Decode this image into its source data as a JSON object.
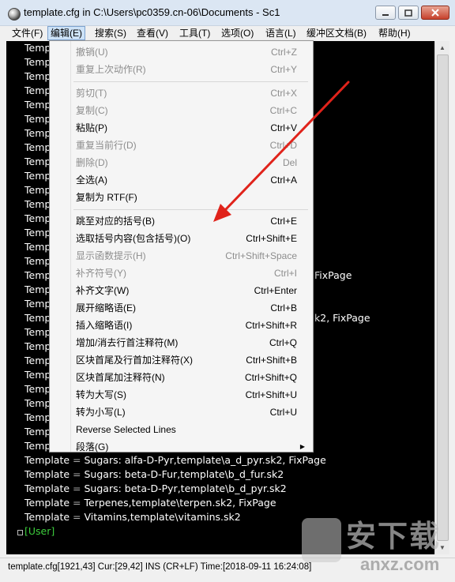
{
  "window": {
    "title": "template.cfg in C:\\Users\\pc0359.cn-06\\Documents - Sc1"
  },
  "menubar": [
    "文件(F)",
    "编辑(E)",
    "搜索(S)",
    "查看(V)",
    "工具(T)",
    "选项(O)",
    "语言(L)",
    "缓冲区文档(B)",
    "帮助(H)"
  ],
  "editor": {
    "hidden_prefix": "Temp",
    "visible_lines": [
      {
        "key": "Template",
        "op": "=",
        "value": "Sugars: alfa-D-Pyr,template\\a_d_pyr.sk2, FixPage"
      },
      {
        "key": "Template",
        "op": "=",
        "value": "Sugars: beta-D-Fur,template\\b_d_fur.sk2"
      },
      {
        "key": "Template",
        "op": "=",
        "value": "Sugars: beta-D-Pyr,template\\b_d_pyr.sk2"
      },
      {
        "key": "Template",
        "op": "=",
        "value": "Terpenes,template\\terpen.sk2, FixPage"
      },
      {
        "key": "Template",
        "op": "=",
        "value": "Vitamins,template\\vitamins.sk2"
      }
    ],
    "section": "[User]",
    "fragments": {
      "fixpage_a": "FixPage",
      "fixpage_b": "k2, FixPage"
    }
  },
  "edit_menu": {
    "items": [
      {
        "label": "撤销(U)",
        "shortcut": "Ctrl+Z",
        "enabled": false
      },
      {
        "label": "重复上次动作(R)",
        "shortcut": "Ctrl+Y",
        "enabled": false
      },
      {
        "label": "剪切(T)",
        "shortcut": "Ctrl+X",
        "enabled": false
      },
      {
        "label": "复制(C)",
        "shortcut": "Ctrl+C",
        "enabled": false
      },
      {
        "label": "粘贴(P)",
        "shortcut": "Ctrl+V",
        "enabled": true
      },
      {
        "label": "重复当前行(D)",
        "shortcut": "Ctrl+D",
        "enabled": false
      },
      {
        "label": "删除(D)",
        "shortcut": "Del",
        "enabled": false
      },
      {
        "label": "全选(A)",
        "shortcut": "Ctrl+A",
        "enabled": true
      },
      {
        "label": "复制为 RTF(F)",
        "shortcut": "",
        "enabled": true
      },
      {
        "label": "跳至对应的括号(B)",
        "shortcut": "Ctrl+E",
        "enabled": true
      },
      {
        "label": "选取括号内容(包含括号)(O)",
        "shortcut": "Ctrl+Shift+E",
        "enabled": true
      },
      {
        "label": "显示函数提示(H)",
        "shortcut": "Ctrl+Shift+Space",
        "enabled": false
      },
      {
        "label": "补齐符号(Y)",
        "shortcut": "Ctrl+I",
        "enabled": false
      },
      {
        "label": "补齐文字(W)",
        "shortcut": "Ctrl+Enter",
        "enabled": true
      },
      {
        "label": "展开缩略语(E)",
        "shortcut": "Ctrl+B",
        "enabled": true
      },
      {
        "label": "插入缩略语(I)",
        "shortcut": "Ctrl+Shift+R",
        "enabled": true
      },
      {
        "label": "增加/消去行首注释符(M)",
        "shortcut": "Ctrl+Q",
        "enabled": true
      },
      {
        "label": "区块首尾及行首加注释符(X)",
        "shortcut": "Ctrl+Shift+B",
        "enabled": true
      },
      {
        "label": "区块首尾加注释符(N)",
        "shortcut": "Ctrl+Shift+Q",
        "enabled": true
      },
      {
        "label": "转为大写(S)",
        "shortcut": "Ctrl+Shift+U",
        "enabled": true
      },
      {
        "label": "转为小写(L)",
        "shortcut": "Ctrl+U",
        "enabled": true
      },
      {
        "label": "Reverse Selected Lines",
        "shortcut": "",
        "enabled": true
      },
      {
        "label": "段落(G)",
        "shortcut": "",
        "enabled": true,
        "submenu": true
      }
    ]
  },
  "statusbar": {
    "text": "template.cfg[1921,43] Cur:[29,42] INS (CR+LF)  Time:[2018-09-11 16:24:08]"
  },
  "watermark": {
    "site": "anxz.com",
    "cn": "安下载"
  },
  "colors": {
    "editor_bg": "#000000",
    "editor_text": "#ffffff",
    "section": "#3ccd3c",
    "arrow": "#e0231b",
    "menu_highlight": "#cde2f7"
  }
}
